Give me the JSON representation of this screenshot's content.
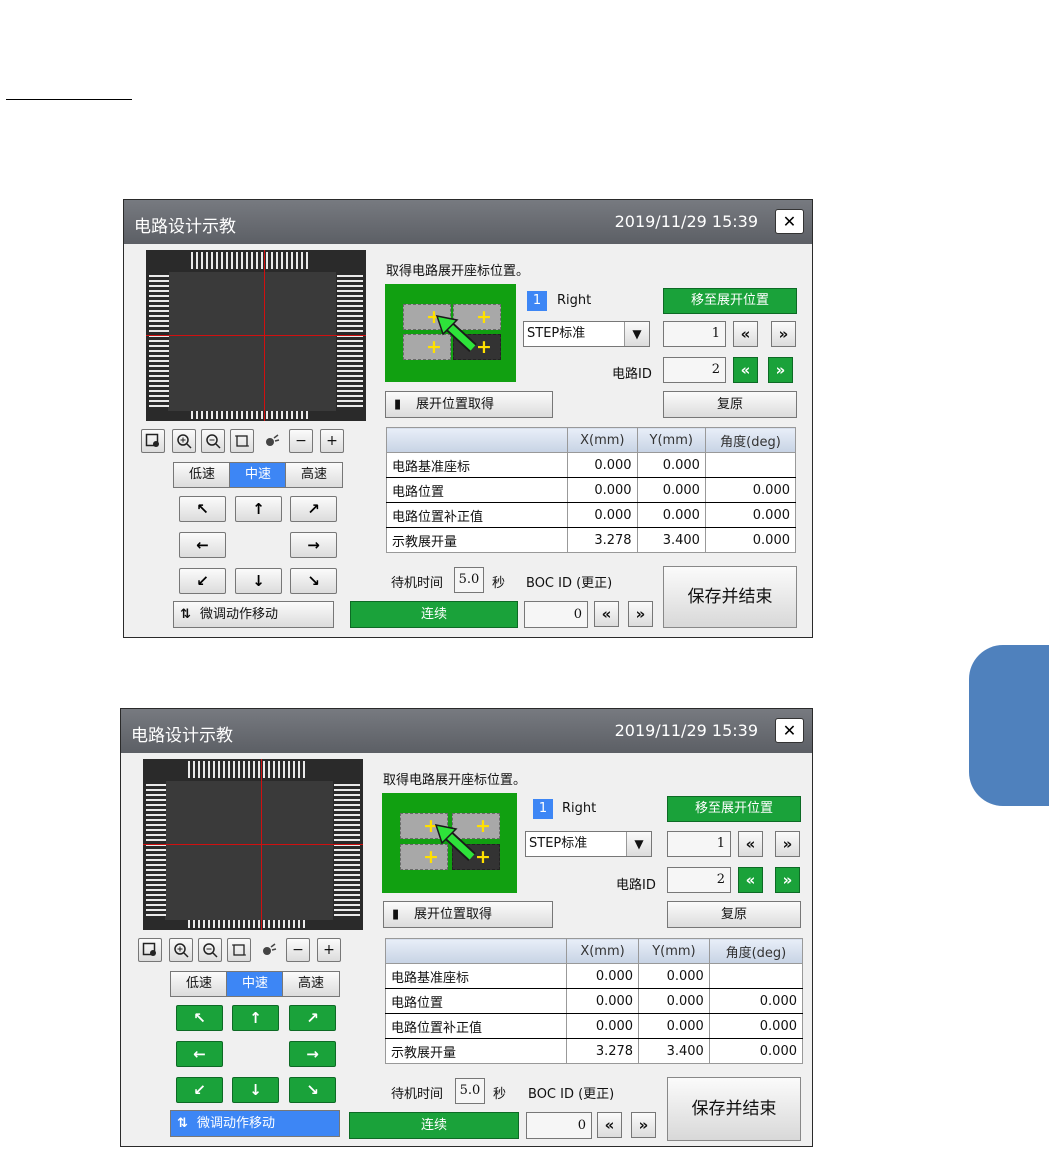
{
  "windows": [
    {
      "title": "电路设计示教",
      "datetime": "2019/11/29 15:39",
      "close_label": "✕",
      "instruction": "取得电路展开座标位置。",
      "lane_number": "1",
      "lane_label": "Right",
      "move_button": "移至展开位置",
      "select_value": "STEP标准",
      "step_value": "1",
      "circuit_id_label": "电路ID",
      "circuit_id_value": "2",
      "get_position_button": "展开位置取得",
      "reset_button": "复原",
      "speed": {
        "low": "低速",
        "mid": "中速",
        "high": "高速",
        "selected": "中速"
      },
      "jog_style": "gray",
      "fine_move_button": "微调动作移动",
      "fine_move_active": false,
      "table": {
        "headers": [
          "",
          "X(mm)",
          "Y(mm)",
          "角度(deg)"
        ],
        "rows": [
          [
            "电路基准座标",
            "0.000",
            "0.000",
            ""
          ],
          [
            "电路位置",
            "0.000",
            "0.000",
            "0.000"
          ],
          [
            "电路位置补正值",
            "0.000",
            "0.000",
            "0.000"
          ],
          [
            "示教展开量",
            "3.278",
            "3.400",
            "0.000"
          ]
        ]
      },
      "wait_label": "待机时间",
      "wait_value": "5.0",
      "wait_unit": "秒",
      "boc_label": "BOC ID (更正)",
      "boc_value": "0",
      "continue_button": "连续",
      "save_button": "保存并结束"
    },
    {
      "title": "电路设计示教",
      "datetime": "2019/11/29 15:39",
      "close_label": "✕",
      "instruction": "取得电路展开座标位置。",
      "lane_number": "1",
      "lane_label": "Right",
      "move_button": "移至展开位置",
      "select_value": "STEP标准",
      "step_value": "1",
      "circuit_id_label": "电路ID",
      "circuit_id_value": "2",
      "get_position_button": "展开位置取得",
      "reset_button": "复原",
      "speed": {
        "low": "低速",
        "mid": "中速",
        "high": "高速",
        "selected": "中速"
      },
      "jog_style": "green",
      "fine_move_button": "微调动作移动",
      "fine_move_active": true,
      "table": {
        "headers": [
          "",
          "X(mm)",
          "Y(mm)",
          "角度(deg)"
        ],
        "rows": [
          [
            "电路基准座标",
            "0.000",
            "0.000",
            ""
          ],
          [
            "电路位置",
            "0.000",
            "0.000",
            "0.000"
          ],
          [
            "电路位置补正值",
            "0.000",
            "0.000",
            "0.000"
          ],
          [
            "示教展开量",
            "3.278",
            "3.400",
            "0.000"
          ]
        ]
      },
      "wait_label": "待机时间",
      "wait_value": "5.0",
      "wait_unit": "秒",
      "boc_label": "BOC ID (更正)",
      "boc_value": "0",
      "continue_button": "连续",
      "save_button": "保存并结束"
    }
  ],
  "icons": {
    "nav_prev": "«",
    "nav_next": "»",
    "jog_up_left": "↖",
    "jog_up": "↑",
    "jog_up_right": "↗",
    "jog_left": "←",
    "jog_right": "→",
    "jog_down_left": "↙",
    "jog_down": "↓",
    "jog_down_right": "↘",
    "minus": "−",
    "plus": "+",
    "dropdown": "▼",
    "pad_cross": "+"
  },
  "colors": {
    "title_bar": "#65686e",
    "accent_blue": "#3d86f5",
    "button_green": "#1aa23a",
    "diagram_green": "#11a011",
    "side_tab": "#4f81bd",
    "crosshair": "#d01010"
  }
}
